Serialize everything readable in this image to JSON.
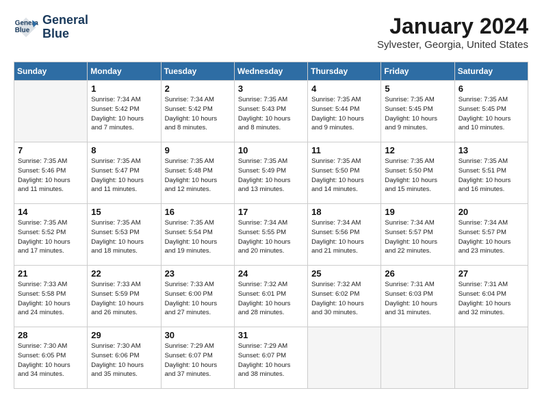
{
  "header": {
    "logo_line1": "General",
    "logo_line2": "Blue",
    "month": "January 2024",
    "location": "Sylvester, Georgia, United States"
  },
  "weekdays": [
    "Sunday",
    "Monday",
    "Tuesday",
    "Wednesday",
    "Thursday",
    "Friday",
    "Saturday"
  ],
  "weeks": [
    [
      {
        "day": "",
        "info": "",
        "empty": true
      },
      {
        "day": "1",
        "info": "Sunrise: 7:34 AM\nSunset: 5:42 PM\nDaylight: 10 hours\nand 7 minutes."
      },
      {
        "day": "2",
        "info": "Sunrise: 7:34 AM\nSunset: 5:42 PM\nDaylight: 10 hours\nand 8 minutes."
      },
      {
        "day": "3",
        "info": "Sunrise: 7:35 AM\nSunset: 5:43 PM\nDaylight: 10 hours\nand 8 minutes."
      },
      {
        "day": "4",
        "info": "Sunrise: 7:35 AM\nSunset: 5:44 PM\nDaylight: 10 hours\nand 9 minutes."
      },
      {
        "day": "5",
        "info": "Sunrise: 7:35 AM\nSunset: 5:45 PM\nDaylight: 10 hours\nand 9 minutes."
      },
      {
        "day": "6",
        "info": "Sunrise: 7:35 AM\nSunset: 5:45 PM\nDaylight: 10 hours\nand 10 minutes."
      }
    ],
    [
      {
        "day": "7",
        "info": "Sunrise: 7:35 AM\nSunset: 5:46 PM\nDaylight: 10 hours\nand 11 minutes."
      },
      {
        "day": "8",
        "info": "Sunrise: 7:35 AM\nSunset: 5:47 PM\nDaylight: 10 hours\nand 11 minutes."
      },
      {
        "day": "9",
        "info": "Sunrise: 7:35 AM\nSunset: 5:48 PM\nDaylight: 10 hours\nand 12 minutes."
      },
      {
        "day": "10",
        "info": "Sunrise: 7:35 AM\nSunset: 5:49 PM\nDaylight: 10 hours\nand 13 minutes."
      },
      {
        "day": "11",
        "info": "Sunrise: 7:35 AM\nSunset: 5:50 PM\nDaylight: 10 hours\nand 14 minutes."
      },
      {
        "day": "12",
        "info": "Sunrise: 7:35 AM\nSunset: 5:50 PM\nDaylight: 10 hours\nand 15 minutes."
      },
      {
        "day": "13",
        "info": "Sunrise: 7:35 AM\nSunset: 5:51 PM\nDaylight: 10 hours\nand 16 minutes."
      }
    ],
    [
      {
        "day": "14",
        "info": "Sunrise: 7:35 AM\nSunset: 5:52 PM\nDaylight: 10 hours\nand 17 minutes."
      },
      {
        "day": "15",
        "info": "Sunrise: 7:35 AM\nSunset: 5:53 PM\nDaylight: 10 hours\nand 18 minutes."
      },
      {
        "day": "16",
        "info": "Sunrise: 7:35 AM\nSunset: 5:54 PM\nDaylight: 10 hours\nand 19 minutes."
      },
      {
        "day": "17",
        "info": "Sunrise: 7:34 AM\nSunset: 5:55 PM\nDaylight: 10 hours\nand 20 minutes."
      },
      {
        "day": "18",
        "info": "Sunrise: 7:34 AM\nSunset: 5:56 PM\nDaylight: 10 hours\nand 21 minutes."
      },
      {
        "day": "19",
        "info": "Sunrise: 7:34 AM\nSunset: 5:57 PM\nDaylight: 10 hours\nand 22 minutes."
      },
      {
        "day": "20",
        "info": "Sunrise: 7:34 AM\nSunset: 5:57 PM\nDaylight: 10 hours\nand 23 minutes."
      }
    ],
    [
      {
        "day": "21",
        "info": "Sunrise: 7:33 AM\nSunset: 5:58 PM\nDaylight: 10 hours\nand 24 minutes."
      },
      {
        "day": "22",
        "info": "Sunrise: 7:33 AM\nSunset: 5:59 PM\nDaylight: 10 hours\nand 26 minutes."
      },
      {
        "day": "23",
        "info": "Sunrise: 7:33 AM\nSunset: 6:00 PM\nDaylight: 10 hours\nand 27 minutes."
      },
      {
        "day": "24",
        "info": "Sunrise: 7:32 AM\nSunset: 6:01 PM\nDaylight: 10 hours\nand 28 minutes."
      },
      {
        "day": "25",
        "info": "Sunrise: 7:32 AM\nSunset: 6:02 PM\nDaylight: 10 hours\nand 30 minutes."
      },
      {
        "day": "26",
        "info": "Sunrise: 7:31 AM\nSunset: 6:03 PM\nDaylight: 10 hours\nand 31 minutes."
      },
      {
        "day": "27",
        "info": "Sunrise: 7:31 AM\nSunset: 6:04 PM\nDaylight: 10 hours\nand 32 minutes."
      }
    ],
    [
      {
        "day": "28",
        "info": "Sunrise: 7:30 AM\nSunset: 6:05 PM\nDaylight: 10 hours\nand 34 minutes."
      },
      {
        "day": "29",
        "info": "Sunrise: 7:30 AM\nSunset: 6:06 PM\nDaylight: 10 hours\nand 35 minutes."
      },
      {
        "day": "30",
        "info": "Sunrise: 7:29 AM\nSunset: 6:07 PM\nDaylight: 10 hours\nand 37 minutes."
      },
      {
        "day": "31",
        "info": "Sunrise: 7:29 AM\nSunset: 6:07 PM\nDaylight: 10 hours\nand 38 minutes."
      },
      {
        "day": "",
        "info": "",
        "empty": true
      },
      {
        "day": "",
        "info": "",
        "empty": true
      },
      {
        "day": "",
        "info": "",
        "empty": true
      }
    ]
  ]
}
